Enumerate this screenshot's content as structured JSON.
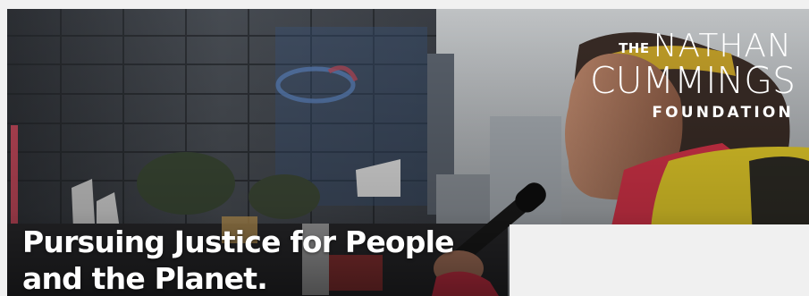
{
  "hero": {
    "image_description_icon": "protest-photo",
    "headline_line1": "Pursuing Justice for People",
    "headline_line2": "and the Planet."
  },
  "logo": {
    "the": "THE",
    "nathan": "NATHAN",
    "cummings": "CUMMINGS",
    "foundation": "FOUNDATION"
  },
  "colors": {
    "page_background": "#f1f1f1",
    "logo_text": "#ffffff",
    "headline_text": "#ffffff",
    "jacket_yellow": "#e8cf2a",
    "scarf_red": "#d9344a"
  }
}
